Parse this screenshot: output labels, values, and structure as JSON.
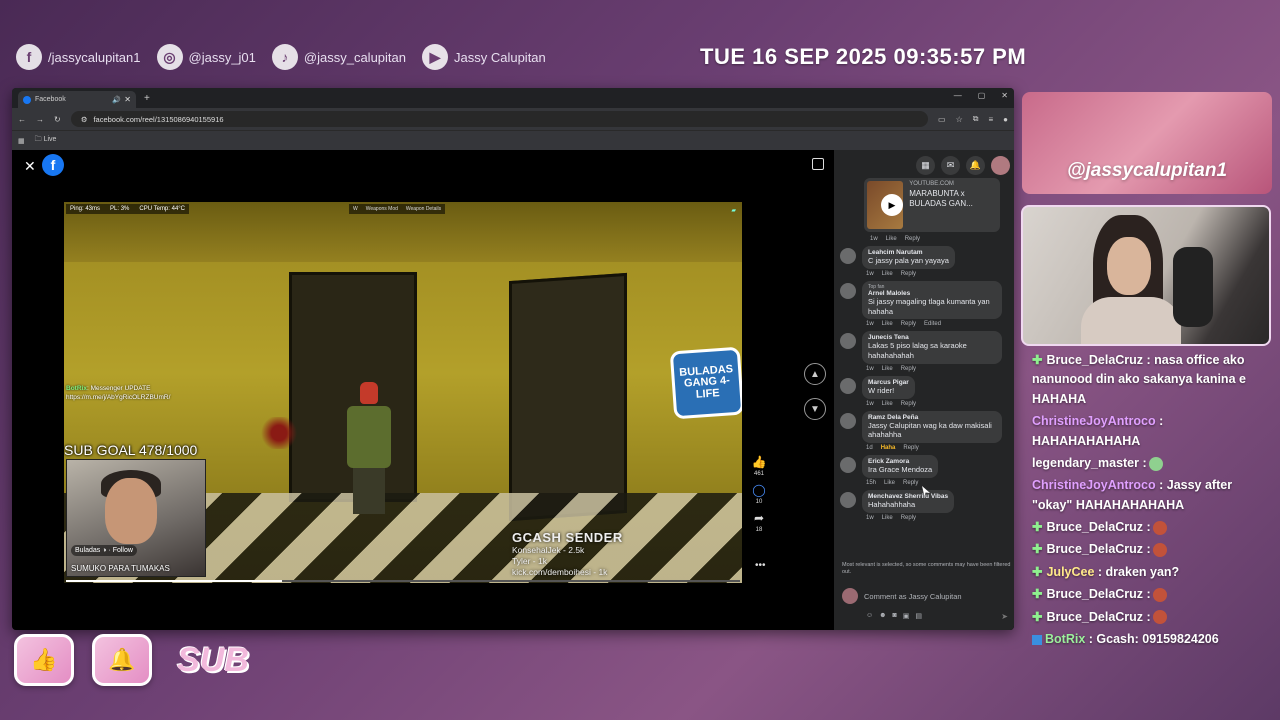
{
  "socials": [
    {
      "icon": "facebook-icon",
      "glyph": "f",
      "handle": "/jassycalupitan1"
    },
    {
      "icon": "instagram-icon",
      "glyph": "◎",
      "handle": "@jassy_j01"
    },
    {
      "icon": "tiktok-icon",
      "glyph": "♪",
      "handle": "@jassy_calupitan"
    },
    {
      "icon": "youtube-icon",
      "glyph": "▶",
      "handle": "Jassy Calupitan"
    }
  ],
  "datetime": "TUE 16 SEP 2025 09:35:57 PM",
  "browser": {
    "tab_title": "Facebook",
    "url": "facebook.com/reel/1315086940155916",
    "bookmark": "Live"
  },
  "video": {
    "hud": [
      "Ping: 43ms",
      "PL: 3%",
      "CPU Temp: 44°C"
    ],
    "hud_mid": [
      "W",
      "Weapons Mod",
      "Weapon Details"
    ],
    "messenger_bot": "BotRix",
    "messenger_text": ": Messenger UPDATE",
    "messenger_link": "https://m.me/j/AbYgRicOLRZBUmR/",
    "sub_goal": "SUB GOAL 478/1000",
    "cam_follow": "Buladas ◑ · Follow",
    "cam_caption": "SUMUKO PARA TUMAKAS",
    "gang_logo": "BULADAS GANG 4-LIFE",
    "gcash_title": "GCASH SENDER",
    "gcash_lines": [
      "KonsehalJek - 2.5k",
      "Tyler - 1k",
      "kick.com/demboihesi - 1k"
    ],
    "progress": 0.32
  },
  "reel_actions": [
    {
      "icon": "like-icon",
      "glyph": "👍",
      "count": "461"
    },
    {
      "icon": "comment-icon",
      "glyph": "◯",
      "count": "10"
    },
    {
      "icon": "share-icon",
      "glyph": "➦",
      "count": "18"
    }
  ],
  "yt_card": {
    "source": "YOUTUBE.COM",
    "title": "MARABUNTA x BULADAS GAN...",
    "meta": [
      "1w",
      "Like",
      "Reply"
    ]
  },
  "comments": [
    {
      "name": "Leahcim Narutam",
      "badge": "",
      "text": "C jassy pala yan yayaya",
      "meta": [
        "1w",
        "Like",
        "Reply"
      ]
    },
    {
      "name": "Arnel Maloles",
      "badge": "Top fan",
      "text": "Si jassy magaling tlaga kumanta yan hahaha",
      "meta": [
        "1w",
        "Like",
        "Reply",
        "Edited"
      ]
    },
    {
      "name": "Junecis Tena",
      "badge": "",
      "text": "Lakas 5 piso lalag sa karaoke hahahahahah",
      "meta": [
        "1w",
        "Like",
        "Reply"
      ]
    },
    {
      "name": "Marcus Pigar",
      "badge": "",
      "text": "W rider!",
      "meta": [
        "1w",
        "Like",
        "Reply"
      ]
    },
    {
      "name": "Ramz Dela Peña",
      "badge": "",
      "text": "Jassy Calupitan wag ka daw makisali ahahahha",
      "meta": [
        "1d",
        "Haha",
        "Reply"
      ]
    },
    {
      "name": "Erick Zamora",
      "badge": "",
      "text": "Ira Grace Mendoza",
      "meta": [
        "15h",
        "Like",
        "Reply"
      ]
    },
    {
      "name": "Menchavez Sherrilu Vibas",
      "badge": "",
      "text": "Hahahahhaha",
      "meta": [
        "1w",
        "Like",
        "Reply"
      ]
    }
  ],
  "comments_notice": "Most relevant is selected, so some comments may have been filtered out.",
  "comment_placeholder": "Comment as Jassy Calupitan",
  "name_banner": "@jassycalupitan1",
  "chat": [
    {
      "user": "Bruce_DelaCruz",
      "cls": "u-bruce",
      "plus": true,
      "msg": ": nasa office ako nanunood din ako sakanya kanina e HAHAHA",
      "emotes": 0
    },
    {
      "user": "ChristineJoyAntroco",
      "cls": "u-christine",
      "plus": false,
      "msg": ": HAHAHAHAHAHA",
      "emotes": 0
    },
    {
      "user": "legendary_master",
      "cls": "u-legend",
      "plus": false,
      "msg": ":",
      "emotes": 1
    },
    {
      "user": "ChristineJoyAntroco",
      "cls": "u-christine",
      "plus": false,
      "msg": ": Jassy after \"okay\" HAHAHAHAHAHA",
      "emotes": 0
    },
    {
      "user": "Bruce_DelaCruz",
      "cls": "u-bruce",
      "plus": true,
      "msg": ":",
      "emotes": 1
    },
    {
      "user": "Bruce_DelaCruz",
      "cls": "u-bruce",
      "plus": true,
      "msg": ":",
      "emotes": 1
    },
    {
      "user": "JulyCee",
      "cls": "u-july",
      "plus": true,
      "msg": ": draken yan?",
      "emotes": 0
    },
    {
      "user": "Bruce_DelaCruz",
      "cls": "u-bruce",
      "plus": true,
      "msg": ":",
      "emotes": 1
    },
    {
      "user": "Bruce_DelaCruz",
      "cls": "u-bruce",
      "plus": true,
      "msg": ":",
      "emotes": 1
    },
    {
      "user": "BotRix",
      "cls": "u-botrix",
      "plus": false,
      "bot": true,
      "msg": ": Gcash: 09159824206",
      "emotes": 0
    }
  ],
  "stickers": [
    "like-sticker",
    "bell-sticker",
    "sub-sticker"
  ],
  "sticker_text": "SUB"
}
